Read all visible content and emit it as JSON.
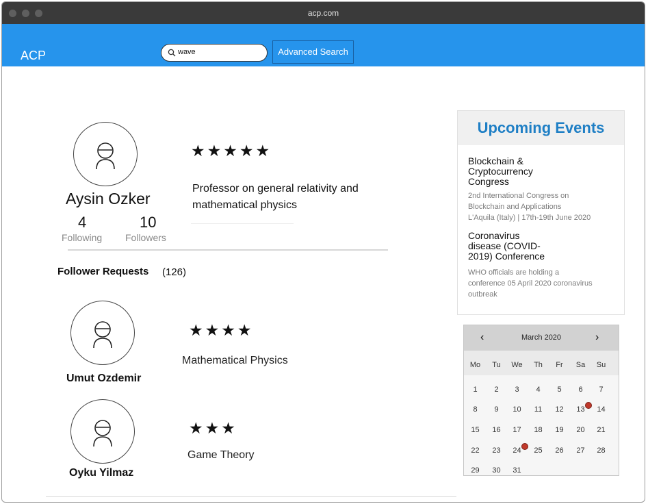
{
  "browser": {
    "url": "acp.com"
  },
  "app": {
    "brand": "ACP",
    "search_value": "wave",
    "advanced_search": "Advanced Search",
    "accent": "#2694ec"
  },
  "profile": {
    "name": "Aysin Ozker",
    "rating": 5,
    "bio": "Professor on general relativity and mathematical physics",
    "following_count": "4",
    "following_label": "Following",
    "followers_count": "10",
    "followers_label": "Followers"
  },
  "requests": {
    "title": "Follower Requests",
    "count": "(126)",
    "items": [
      {
        "name": "Umut Ozdemir",
        "topic": "Mathematical Physics",
        "rating": 4
      },
      {
        "name": "Oyku Yilmaz",
        "topic": "Game Theory",
        "rating": 3
      }
    ]
  },
  "events": {
    "heading": "Upcoming Events",
    "items": [
      {
        "title_lines": [
          "Blockchain &",
          "Cryptocurrency",
          "Congress"
        ],
        "desc_lines": [
          "2nd International Congress on",
          "Blockchain and Applications",
          "L'Aquila (Italy) | 17th-19th June 2020"
        ]
      },
      {
        "title_lines": [
          "Coronavirus",
          "disease (COVID-",
          "2019) Conference"
        ],
        "desc_lines": [
          "WHO officials are holding a",
          "conference 05 April 2020 coronavirus",
          "outbreak"
        ]
      }
    ]
  },
  "calendar": {
    "month": "March 2020",
    "prev": "‹",
    "next": "›",
    "weekdays": [
      "Mo",
      "Tu",
      "We",
      "Th",
      "Fr",
      "Sa",
      "Su"
    ],
    "weeks": [
      [
        "1",
        "2",
        "3",
        "4",
        "5",
        "6",
        "7"
      ],
      [
        "8",
        "9",
        "10",
        "11",
        "12",
        "13",
        "14"
      ],
      [
        "15",
        "16",
        "17",
        "18",
        "19",
        "20",
        "21"
      ],
      [
        "22",
        "23",
        "24",
        "25",
        "26",
        "27",
        "28"
      ],
      [
        "29",
        "30",
        "31"
      ]
    ],
    "event_days": [
      "13",
      "24"
    ],
    "event_dot_color": "#c0392b"
  }
}
